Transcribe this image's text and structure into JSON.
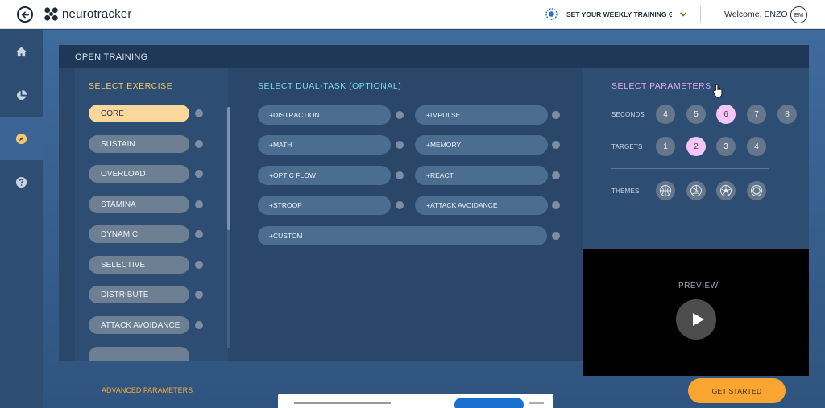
{
  "topbar": {
    "logo_text": "neurotracker",
    "goal_text": "SET YOUR WEEKLY TRAINING GOAL!",
    "welcome": "Welcome, ENZO",
    "avatar_initials": "EM"
  },
  "nav": {
    "items": [
      "home-icon",
      "stats-icon",
      "training-icon",
      "help-icon"
    ],
    "active_index": 2
  },
  "panel": {
    "title": "OPEN TRAINING"
  },
  "exercise": {
    "title": "SELECT EXERCISE",
    "items": [
      "CORE",
      "SUSTAIN",
      "OVERLOAD",
      "STAMINA",
      "DYNAMIC",
      "SELECTIVE",
      "DISTRIBUTE",
      "ATTACK AVOIDANCE"
    ],
    "selected": "CORE"
  },
  "dual_task": {
    "title": "SELECT DUAL-TASK (OPTIONAL)",
    "items": [
      "+DISTRACTION",
      "+IMPULSE",
      "+MATH",
      "+MEMORY",
      "+OPTIC FLOW",
      "+REACT",
      "+STROOP",
      "+ATTACK AVOIDANCE",
      "+CUSTOM"
    ]
  },
  "parameters": {
    "title": "SELECT PARAMETERS",
    "seconds_label": "SECONDS",
    "seconds": [
      "4",
      "5",
      "6",
      "7",
      "8"
    ],
    "seconds_selected": "6",
    "targets_label": "TARGETS",
    "targets": [
      "1",
      "2",
      "3",
      "4"
    ],
    "targets_selected": "2",
    "themes_label": "THEMES",
    "themes": [
      "basketball-icon",
      "volleyball-icon",
      "soccer-ball-icon",
      "ring-icon"
    ]
  },
  "preview": {
    "label": "PREVIEW"
  },
  "footer": {
    "advanced": "ADVANCED PARAMETERS",
    "start": "GET STARTED"
  },
  "colors": {
    "accent_yellow": "#fcd79b",
    "accent_cyan": "#7fd9ea",
    "accent_pink": "#f6c5f7",
    "cta_orange": "#f9a532"
  }
}
